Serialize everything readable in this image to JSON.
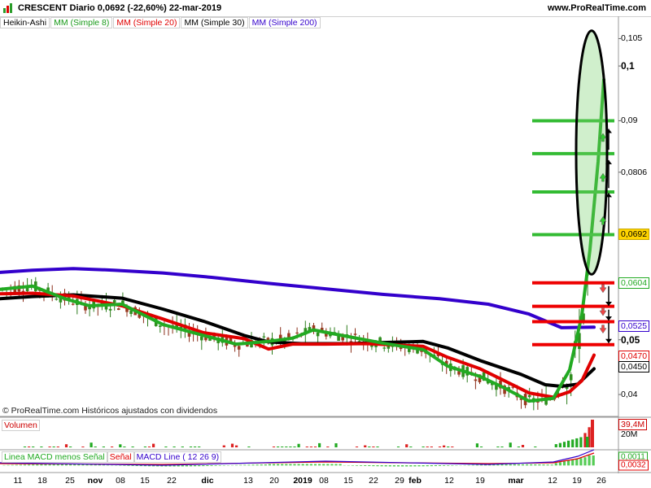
{
  "header": {
    "title": "CRESCENT   Diario   0,0692 (-22,60%)   22-mar-2019",
    "site": "www.ProRealTime.com"
  },
  "legend": {
    "items": [
      {
        "label": "Heikin-Ashi",
        "color": "#000000"
      },
      {
        "label": "MM (Simple 8)",
        "color": "#1a9a1a"
      },
      {
        "label": "MM (Simple 20)",
        "color": "#e00000"
      },
      {
        "label": "MM (Simple 30)",
        "color": "#000000"
      },
      {
        "label": "MM (Simple 200)",
        "color": "#3300cc"
      }
    ]
  },
  "copyright": "© ProRealTime.com  Históricos ajustados con dividendos",
  "volume_panel": {
    "label": "Volumen",
    "last_value": "39,4M",
    "scale_label": "20M"
  },
  "macd_panel": {
    "labels": [
      {
        "text": "Linea MACD menos Señal",
        "color": "#22aa22"
      },
      {
        "text": "Señal",
        "color": "#e00000"
      },
      {
        "text": "MACD Line ( 12 26 9)",
        "color": "#3300cc"
      }
    ],
    "values": [
      "0,0011",
      "0,0032"
    ]
  },
  "chart_data": {
    "type": "candlestick",
    "price_axis": {
      "ylim": [
        0.036,
        0.107
      ],
      "ticks": [
        "0,105",
        "0,1",
        "0,09",
        "0,0806",
        "0,0604",
        "0,0525",
        "0,05",
        "0,0470",
        "0,0450",
        "0,04"
      ],
      "tick_values": [
        0.105,
        0.1,
        0.09,
        0.0806,
        0.0604,
        0.0525,
        0.05,
        0.047,
        0.045,
        0.04
      ],
      "bold_ticks": [
        "0,1",
        "0,05"
      ],
      "current_price": "0,0692"
    },
    "x_ticks": [
      "11",
      "18",
      "25",
      "nov",
      "08",
      "15",
      "22",
      "dic",
      "13",
      "20",
      "2019",
      "08",
      "15",
      "22",
      "29",
      "feb",
      "12",
      "19",
      "mar",
      "12",
      "19",
      "26"
    ],
    "bold_x_ticks": [
      "nov",
      "dic",
      "2019",
      "feb",
      "mar"
    ],
    "resistance_levels": [
      0.09,
      0.084,
      0.077,
      0.0692
    ],
    "support_levels": [
      0.0604,
      0.0561,
      0.0533,
      0.0491
    ],
    "series": [
      {
        "name": "MM (Simple 200)",
        "color": "#3300cc",
        "points": [
          [
            0,
            0.0623
          ],
          [
            40,
            0.0627
          ],
          [
            90,
            0.063
          ],
          [
            140,
            0.0627
          ],
          [
            200,
            0.0622
          ],
          [
            260,
            0.0614
          ],
          [
            330,
            0.0603
          ],
          [
            400,
            0.0593
          ],
          [
            470,
            0.0583
          ],
          [
            540,
            0.0575
          ],
          [
            600,
            0.0565
          ],
          [
            650,
            0.0547
          ],
          [
            690,
            0.0522
          ],
          [
            730,
            0.0523
          ]
        ]
      },
      {
        "name": "MM (Simple 30)",
        "color": "#000000",
        "points": [
          [
            0,
            0.0575
          ],
          [
            40,
            0.0579
          ],
          [
            90,
            0.0582
          ],
          [
            150,
            0.0576
          ],
          [
            200,
            0.0556
          ],
          [
            250,
            0.0534
          ],
          [
            300,
            0.0508
          ],
          [
            330,
            0.0496
          ],
          [
            370,
            0.0493
          ],
          [
            430,
            0.0493
          ],
          [
            470,
            0.0495
          ],
          [
            520,
            0.0497
          ],
          [
            550,
            0.0485
          ],
          [
            590,
            0.0462
          ],
          [
            640,
            0.0437
          ],
          [
            670,
            0.0418
          ],
          [
            690,
            0.0415
          ],
          [
            710,
            0.0419
          ],
          [
            730,
            0.0447
          ]
        ]
      },
      {
        "name": "MM (Simple 20)",
        "color": "#e00000",
        "points": [
          [
            0,
            0.0584
          ],
          [
            40,
            0.0585
          ],
          [
            90,
            0.058
          ],
          [
            150,
            0.0562
          ],
          [
            200,
            0.0538
          ],
          [
            250,
            0.0513
          ],
          [
            300,
            0.0502
          ],
          [
            330,
            0.0483
          ],
          [
            360,
            0.0492
          ],
          [
            400,
            0.0492
          ],
          [
            450,
            0.0493
          ],
          [
            520,
            0.0488
          ],
          [
            550,
            0.0468
          ],
          [
            590,
            0.0447
          ],
          [
            620,
            0.0425
          ],
          [
            650,
            0.0403
          ],
          [
            680,
            0.0395
          ],
          [
            700,
            0.0405
          ],
          [
            715,
            0.0425
          ],
          [
            730,
            0.0472
          ]
        ]
      },
      {
        "name": "MM (Simple 8)",
        "color": "#22aa22",
        "points": [
          [
            0,
            0.0592
          ],
          [
            40,
            0.0598
          ],
          [
            80,
            0.0575
          ],
          [
            110,
            0.0562
          ],
          [
            150,
            0.0565
          ],
          [
            200,
            0.0528
          ],
          [
            240,
            0.0512
          ],
          [
            290,
            0.0492
          ],
          [
            330,
            0.0497
          ],
          [
            360,
            0.0503
          ],
          [
            385,
            0.0518
          ],
          [
            420,
            0.0508
          ],
          [
            470,
            0.0494
          ],
          [
            520,
            0.0482
          ],
          [
            550,
            0.0452
          ],
          [
            590,
            0.0433
          ],
          [
            620,
            0.0412
          ],
          [
            650,
            0.0388
          ],
          [
            680,
            0.0393
          ],
          [
            700,
            0.0445
          ],
          [
            715,
            0.0545
          ],
          [
            725,
            0.0665
          ],
          [
            735,
            0.0825
          ],
          [
            742,
            0.0975
          ]
        ]
      }
    ]
  }
}
